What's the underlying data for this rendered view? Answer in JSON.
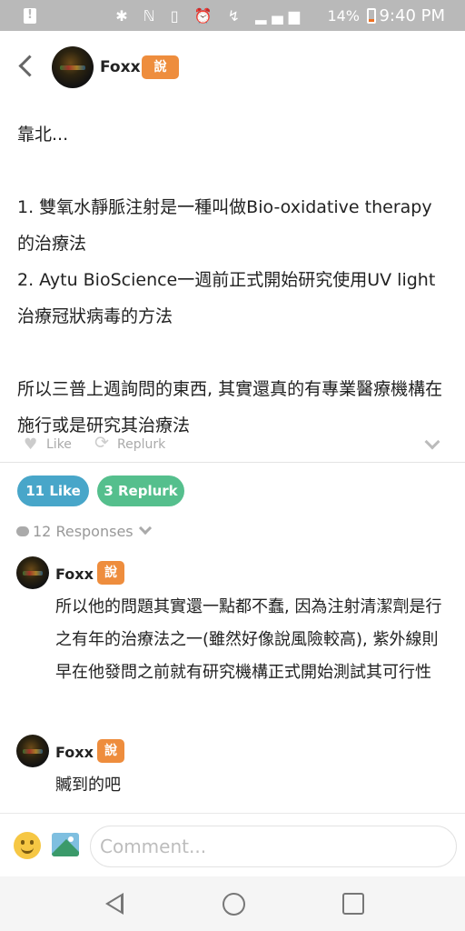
{
  "status_bar": {
    "icons": "✱ ℕ ▯ ⏰ ↯ ▂▄▆",
    "battery_percent": "14%",
    "time": "9:40 PM"
  },
  "header": {
    "author_name": "Foxx",
    "qualifier": "說"
  },
  "plurk": {
    "lines": [
      "靠北...",
      "",
      "1. 雙氧水靜脈注射是一種叫做Bio-oxidative therapy的治療法",
      "2. Aytu BioScience一週前正式開始研究使用UV light治療冠狀病毒的方法",
      "",
      "所以三普上週詢問的東西, 其實還真的有專業醫療機構在施行或是研究其治療法"
    ],
    "like_label": "Like",
    "replurk_label": "Replurk"
  },
  "stats": {
    "like_count_label": "11 Like",
    "replurk_count_label": "3 Replurk",
    "responses_label": "12 Responses"
  },
  "responses": [
    {
      "name": "Foxx",
      "qualifier": "說",
      "text": "所以他的問題其實還一點都不蠢, 因為注射清潔劑是行之有年的治療法之一(雖然好像說風險較高), 紫外線則早在他發問之前就有研究機構正式開始測試其可行性"
    },
    {
      "name": "Foxx",
      "qualifier": "說",
      "text": "贓到的吧"
    }
  ],
  "comment": {
    "placeholder": "Comment..."
  },
  "colors": {
    "qualifier_orange": "#ee8d3d",
    "like_blue": "#48a6c9",
    "replurk_green": "#55bf8d",
    "status_bar_gray": "#b9b9b9"
  }
}
